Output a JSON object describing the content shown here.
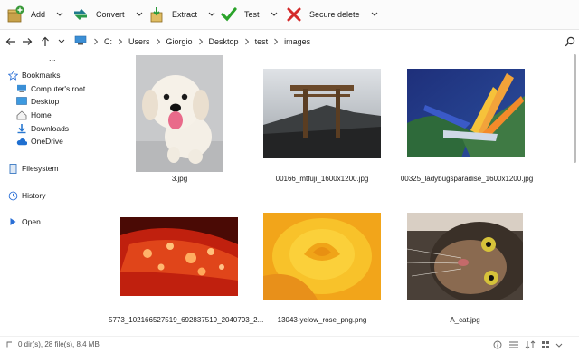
{
  "toolbar": {
    "buttons": [
      {
        "label": "Add",
        "icon": "add-archive-icon"
      },
      {
        "label": "Convert",
        "icon": "convert-icon"
      },
      {
        "label": "Extract",
        "icon": "extract-icon"
      },
      {
        "label": "Test",
        "icon": "test-checkmark-icon"
      },
      {
        "label": "Secure delete",
        "icon": "secure-delete-icon"
      }
    ]
  },
  "address": {
    "path": [
      "C:",
      "Users",
      "Giorgio",
      "Desktop",
      "test",
      "images"
    ]
  },
  "sidebar": {
    "overflow": "...",
    "items": [
      {
        "label": "Bookmarks",
        "icon": "star-icon"
      },
      {
        "label": "Computer's root",
        "icon": "computer-icon"
      },
      {
        "label": "Desktop",
        "icon": "desktop-icon"
      },
      {
        "label": "Home",
        "icon": "home-icon"
      },
      {
        "label": "Downloads",
        "icon": "download-icon"
      },
      {
        "label": "OneDrive",
        "icon": "cloud-icon"
      },
      {
        "label": "Filesystem",
        "icon": "filesystem-icon"
      },
      {
        "label": "History",
        "icon": "history-icon"
      },
      {
        "label": "Open",
        "icon": "open-icon"
      }
    ]
  },
  "files": [
    {
      "name": "3.jpg",
      "subject": "white puppy"
    },
    {
      "name": "00166_mtfuji_1600x1200.jpg",
      "subject": "torii gate mountain"
    },
    {
      "name": "00325_ladybugsparadise_1600x1200.jpg",
      "subject": "bird of paradise flower"
    },
    {
      "name": "5773_102166527519_692837519_2040793_2...",
      "subject": "red leaf water drops"
    },
    {
      "name": "13043-yelow_rose_png.png",
      "subject": "yellow rose"
    },
    {
      "name": "A_cat.jpg",
      "subject": "cat close-up"
    }
  ],
  "status": {
    "text": "0 dir(s), 28 file(s), 8.4 MB"
  }
}
